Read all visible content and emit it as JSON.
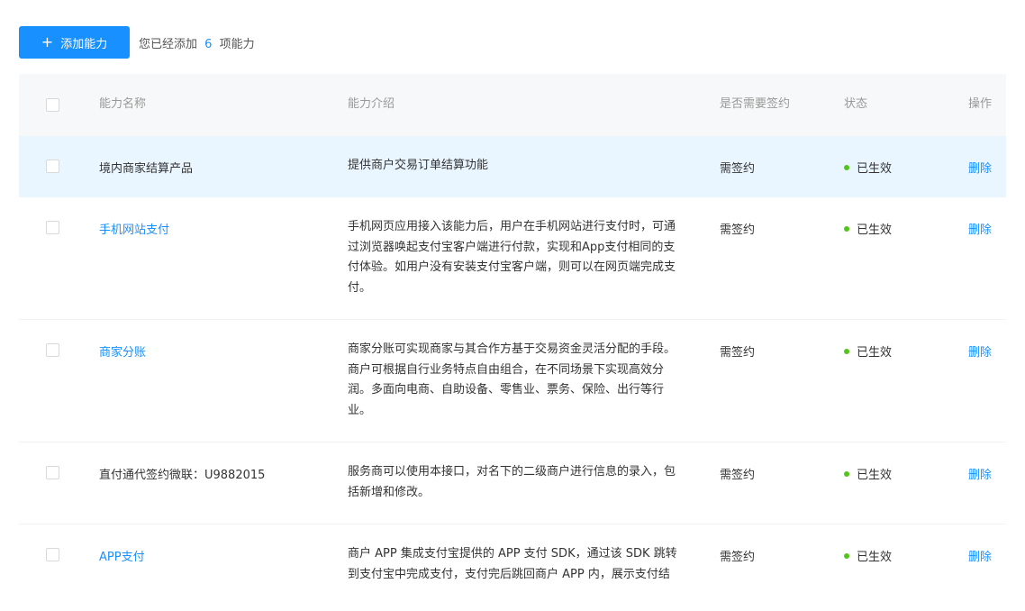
{
  "toolbar": {
    "add_icon": "plus-icon",
    "add_label": "添加能力",
    "count_prefix": "您已经添加",
    "count_value": "6",
    "count_suffix": "项能力"
  },
  "table": {
    "headers": {
      "name": "能力名称",
      "desc": "能力介绍",
      "sign": "是否需要签约",
      "status": "状态",
      "op": "操作"
    },
    "rows": [
      {
        "name": "境内商家结算产品",
        "desc": "提供商户交易订单结算功能",
        "sign": "需签约",
        "status": "已生效",
        "op": "删除"
      },
      {
        "name": "手机网站支付",
        "desc_lines": [
          "手机网页应用接入该能力后，用户在手机网站进行支付时，可通",
          "过浏览器唤起支付宝客户端进行付款，实现和App支付相同的支",
          "付体验。如用户没有安装支付宝客户端，则可以在网页端完成支",
          "付。"
        ],
        "sign": "需签约",
        "status": "已生效",
        "op": "删除"
      },
      {
        "name": "商家分账",
        "desc_lines": [
          "商家分账可实现商家与其合作方基于交易资金灵活分配的手段。",
          "商户可根据自行业务特点自由组合，在不同场景下实现高效分",
          "润。多面向电商、自助设备、零售业、票务、保险、出行等行",
          "业。"
        ],
        "sign": "需签约",
        "status": "已生效",
        "op": "删除"
      },
      {
        "name": "直付通代签约微联：U9882015",
        "desc_lines": [
          "服务商可以使用本接口，对名下的二级商户进行信息的录入，包",
          "括新增和修改。"
        ],
        "sign": "需签约",
        "status": "已生效",
        "op": "删除"
      },
      {
        "name": "APP支付",
        "desc_lines": [
          "商户 APP 集成支付宝提供的 APP 支付 SDK，通过该 SDK 跳转",
          "到支付宝中完成支付，支付完后跳回商户 APP 内，展示支付结"
        ],
        "sign": "需签约",
        "status": "已生效",
        "op": "删除"
      }
    ]
  },
  "colors": {
    "primary": "#1890ff",
    "status_active": "#52c41a",
    "header_bg": "#f7f8f9",
    "row_highlight": "#e9f5ff"
  }
}
